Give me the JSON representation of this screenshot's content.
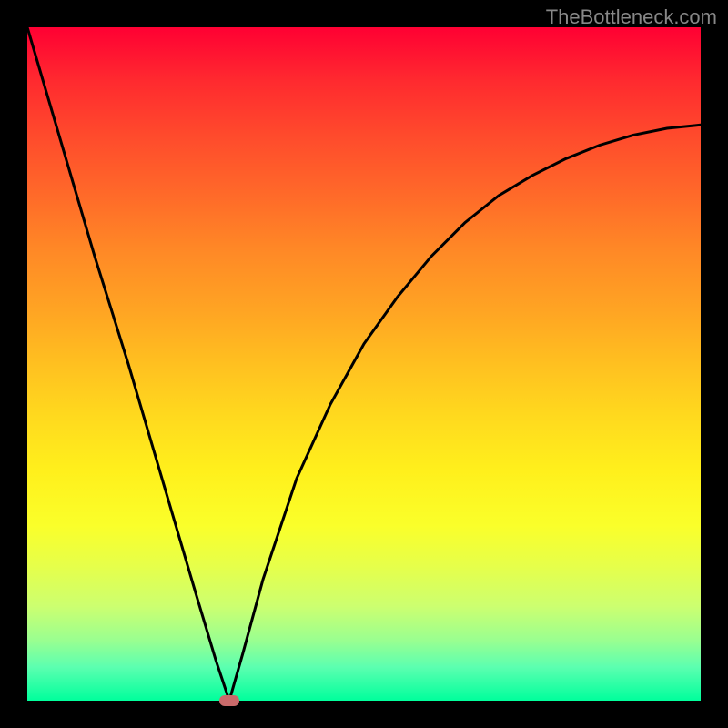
{
  "watermark": "TheBottleneck.com",
  "chart_data": {
    "type": "line",
    "title": "",
    "xlabel": "",
    "ylabel": "",
    "xlim": [
      0,
      100
    ],
    "ylim": [
      0,
      100
    ],
    "series": [
      {
        "name": "curve",
        "x": [
          0,
          5,
          10,
          15,
          20,
          25,
          28,
          30,
          32,
          35,
          40,
          45,
          50,
          55,
          60,
          65,
          70,
          75,
          80,
          85,
          90,
          95,
          100
        ],
        "y": [
          100,
          83,
          66,
          50,
          33,
          16,
          6,
          0,
          7,
          18,
          33,
          44,
          53,
          60,
          66,
          71,
          75,
          78,
          80.5,
          82.5,
          84,
          85,
          85.5
        ]
      }
    ],
    "marker": {
      "x": 30,
      "y": 0
    },
    "gradient_stops": [
      {
        "pos": 0,
        "color": "#ff0033"
      },
      {
        "pos": 100,
        "color": "#00ff9c"
      }
    ]
  }
}
